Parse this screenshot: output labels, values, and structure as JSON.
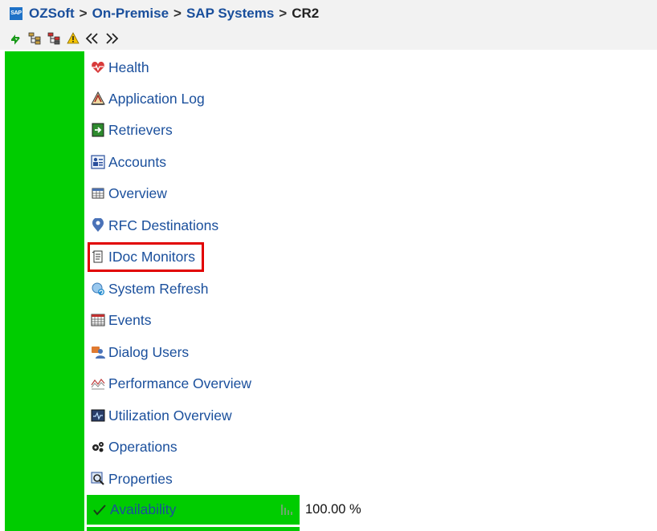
{
  "breadcrumb": {
    "items": [
      "OZSoft",
      "On-Premise",
      "SAP Systems",
      "CR2"
    ],
    "separator": ">"
  },
  "toolbar": {
    "icons": [
      "refresh-icon",
      "hierarchy-icon",
      "alert-tree-icon",
      "warning-icon",
      "collapse-left-icon",
      "expand-right-icon"
    ]
  },
  "menu": {
    "items": [
      {
        "label": "Health",
        "icon": "heart-pulse-icon"
      },
      {
        "label": "Application Log",
        "icon": "application-log-icon"
      },
      {
        "label": "Retrievers",
        "icon": "retrievers-icon"
      },
      {
        "label": "Accounts",
        "icon": "accounts-icon"
      },
      {
        "label": "Overview",
        "icon": "overview-icon"
      },
      {
        "label": "RFC Destinations",
        "icon": "location-pin-icon"
      },
      {
        "label": "IDoc Monitors",
        "icon": "idoc-document-icon"
      },
      {
        "label": "System Refresh",
        "icon": "system-refresh-icon"
      },
      {
        "label": "Events",
        "icon": "calendar-icon"
      },
      {
        "label": "Dialog Users",
        "icon": "dialog-users-icon"
      },
      {
        "label": "Performance Overview",
        "icon": "performance-icon"
      },
      {
        "label": "Utilization Overview",
        "icon": "utilization-monitor-icon"
      },
      {
        "label": "Operations",
        "icon": "gears-icon"
      },
      {
        "label": "Properties",
        "icon": "properties-icon"
      }
    ],
    "highlighted": "IDoc Monitors"
  },
  "availability": {
    "label": "Availability",
    "value": "100.00 %",
    "status_color": "#00cc00"
  },
  "colors": {
    "link": "#1a4f9c",
    "status_green": "#00cc00",
    "highlight_red": "#e10000"
  }
}
